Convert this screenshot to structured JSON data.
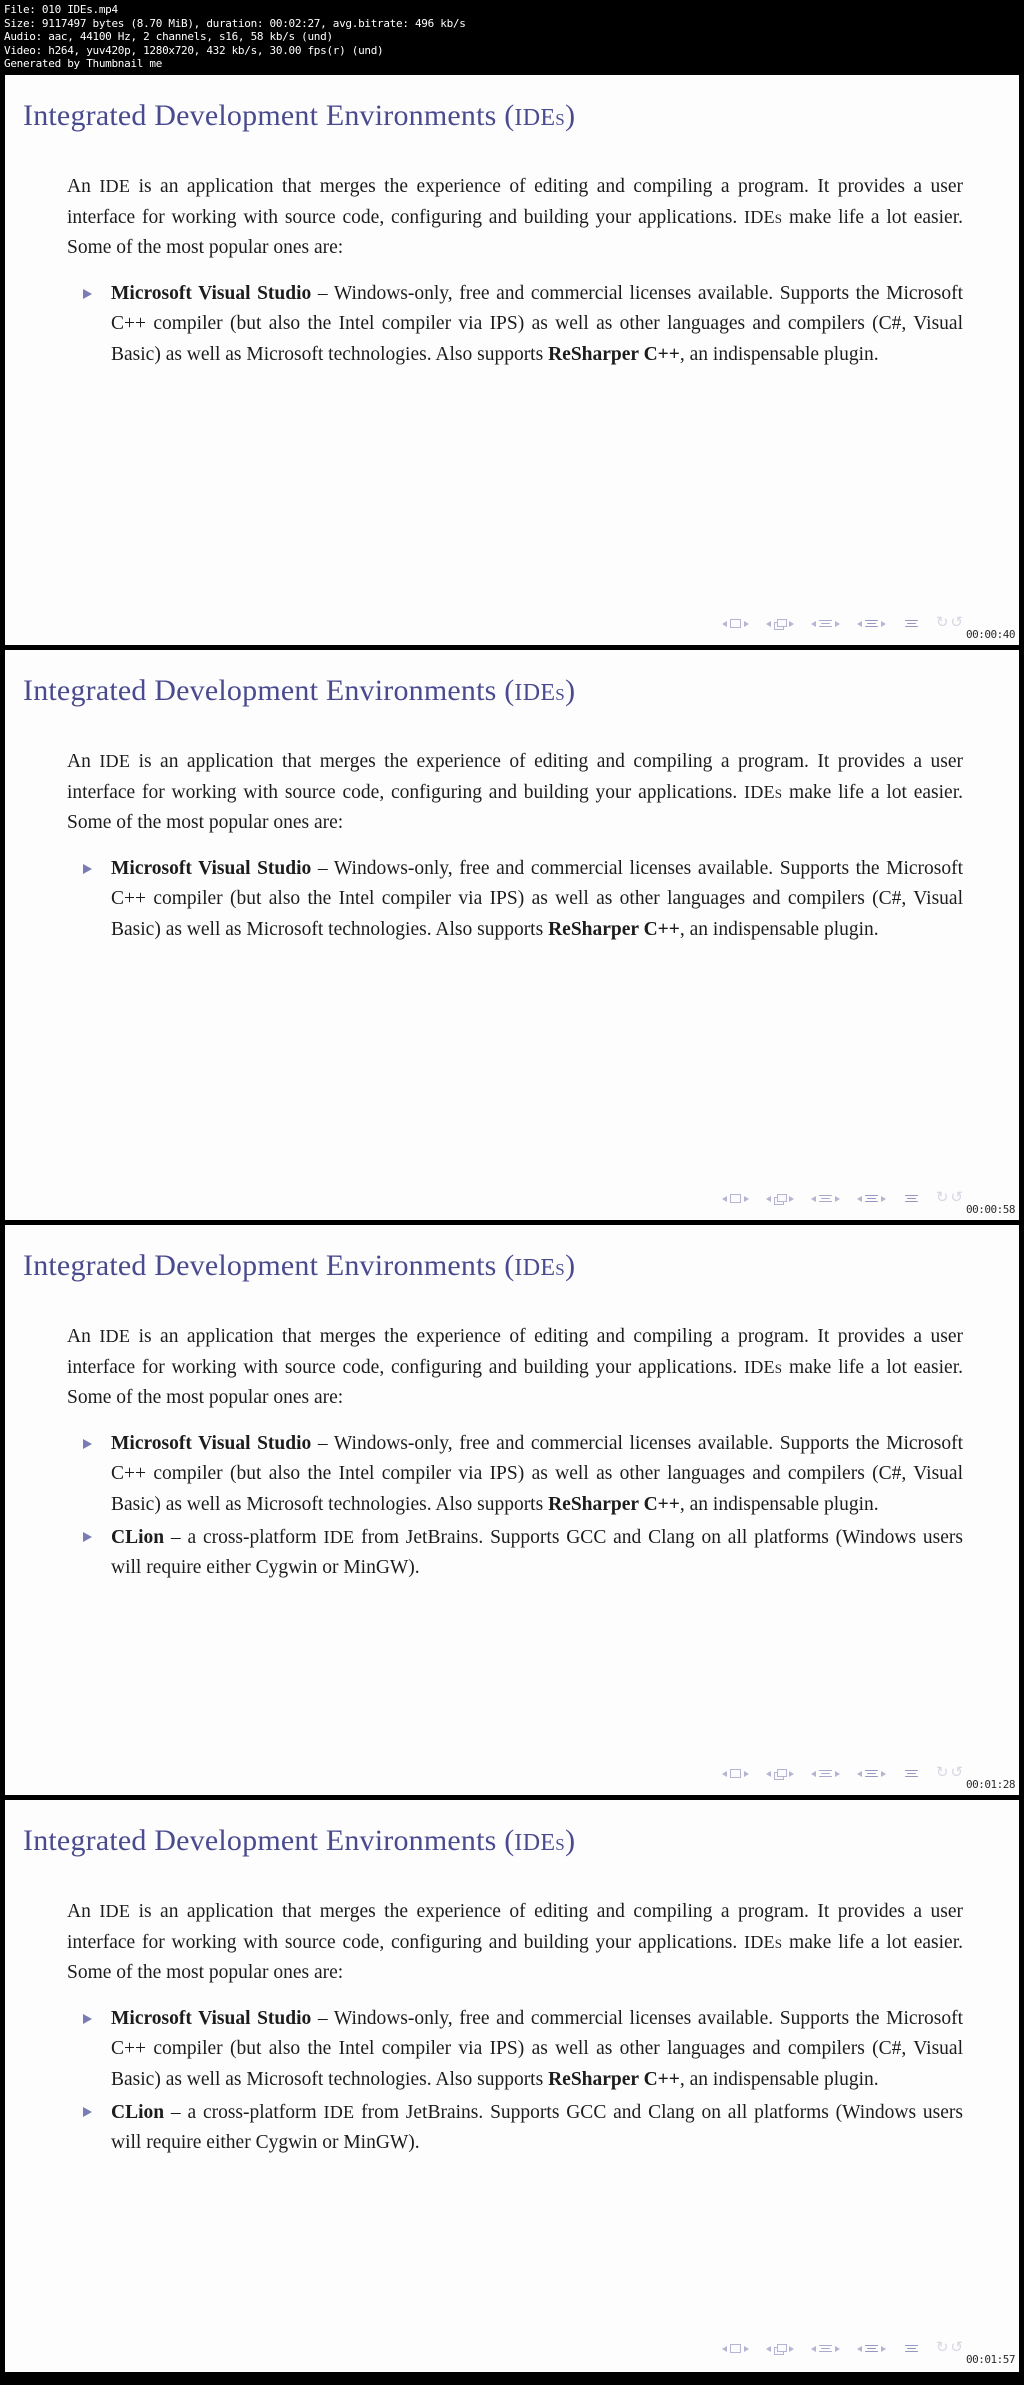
{
  "meta": {
    "line1": "File: 010 IDEs.mp4",
    "line2": "Size: 9117497 bytes (8.70 MiB), duration: 00:02:27, avg.bitrate: 496 kb/s",
    "line3": "Audio: aac, 44100 Hz, 2 channels, s16, 58 kb/s (und)",
    "line4": "Video: h264, yuv420p, 1280x720, 432 kb/s, 30.00 fps(r) (und)",
    "line5": "Generated by Thumbnail me"
  },
  "slide_common": {
    "title_main": "Integrated Development Environments (",
    "title_abbr": "IDEs",
    "title_close": ")",
    "para_a": "An ",
    "para_abbr1": "IDE",
    "para_b": " is an application that merges the experience of editing and compiling a program. It provides a user interface for working with source code, configuring and building your applications. ",
    "para_abbr2": "IDEs",
    "para_c": " make life a lot easier. Some of the most popular ones are:",
    "bullet_vs_name": "Microsoft Visual Studio",
    "bullet_vs_text": " – Windows-only, free and commercial licenses available. Supports the Microsoft C++ compiler (but also the Intel compiler via IPS) as well as other languages and compilers (C#, Visual Basic) as well as Microsoft technologies. Also supports ",
    "bullet_vs_name2": "ReSharper C++",
    "bullet_vs_text2": ", an indispensable plugin.",
    "bullet_cl_name": "CLion",
    "bullet_cl_text_a": " – a cross-platform ",
    "bullet_cl_abbr": "IDE",
    "bullet_cl_text_b": " from JetBrains. Supports GCC and Clang on all platforms (Windows users will require either Cygwin or MinGW)."
  },
  "slides": [
    {
      "timestamp": "00:00:40",
      "has_clion": false
    },
    {
      "timestamp": "00:00:58",
      "has_clion": false
    },
    {
      "timestamp": "00:01:28",
      "has_clion": true
    },
    {
      "timestamp": "00:01:57",
      "has_clion": true
    }
  ],
  "colors": {
    "title": "#4a4a8f",
    "bullet": "#7b7bb5",
    "slide_bg": "#fdfdfd",
    "page_bg": "#000000",
    "meta_text": "#ffffff"
  }
}
